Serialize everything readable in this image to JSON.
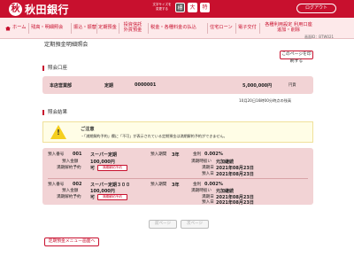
{
  "header": {
    "logo_mark": "秋",
    "bank_name": "秋田銀行",
    "fontsize_label": "文字サイズを変更する",
    "font_sizes": [
      "標",
      "大",
      "特"
    ],
    "logout": "ログアウト"
  },
  "nav": {
    "items": [
      "ホーム",
      "残高・明細照会",
      "振込・振替",
      "定期預金",
      "投資信託 外貨預金",
      "税金・各種料金の払込",
      "住宅ローン",
      "電子交付",
      "各種利用設定 利用口座追加・削除"
    ]
  },
  "screen_id": "画面ID：BTW021",
  "page_title": "定期預金明細照会",
  "print_button": "このページを印刷する",
  "account_section": {
    "label": "照会口座",
    "branch": "本店営業部",
    "type": "定期",
    "number": "0000001",
    "amount": "5,000,000円",
    "currency": "円貨"
  },
  "as_of": "10月20日16時00分時点の残高",
  "result_section": {
    "label": "照会結果"
  },
  "caution": {
    "title": "ご注意",
    "text": "「満期解約予約」欄に「不可」が表示されている定期預金は満期解約予約ができません。"
  },
  "records": [
    {
      "deposit_no_label": "預入番号",
      "deposit_no": "001",
      "product": "スーパー定期",
      "deposit_amount_label": "預入金額",
      "deposit_amount": "100,000円",
      "maturity_reservation_label": "満期解約予約",
      "maturity_reservation": "可",
      "maturity_reservation_button": "満期解約予約",
      "period_label": "預入期間",
      "period": "3年",
      "rate_label": "金利",
      "rate": "0.002%",
      "method_label": "満期時扱い",
      "method": "元加継続",
      "maturity_date_label": "満期日",
      "maturity_date": "2021年08月23日",
      "deposit_date_label": "預入日",
      "deposit_date": "2021年08月23日"
    },
    {
      "deposit_no_label": "預入番号",
      "deposit_no": "002",
      "product": "スーパー定期３００",
      "deposit_amount_label": "預入金額",
      "deposit_amount": "100,000円",
      "maturity_reservation_label": "満期解約予約",
      "maturity_reservation": "可",
      "maturity_reservation_button": "満期解約予約",
      "period_label": "預入期間",
      "period": "3年",
      "rate_label": "金利",
      "rate": "0.002%",
      "method_label": "満期時扱い",
      "method": "元加継続",
      "maturity_date_label": "満期日",
      "maturity_date": "2021年08月23日",
      "deposit_date_label": "預入日",
      "deposit_date": "2021年08月23日"
    }
  ],
  "pagination": {
    "prev": "前ページ",
    "next": "次ページ"
  },
  "menu_button": "定期預金メニュー画面へ"
}
